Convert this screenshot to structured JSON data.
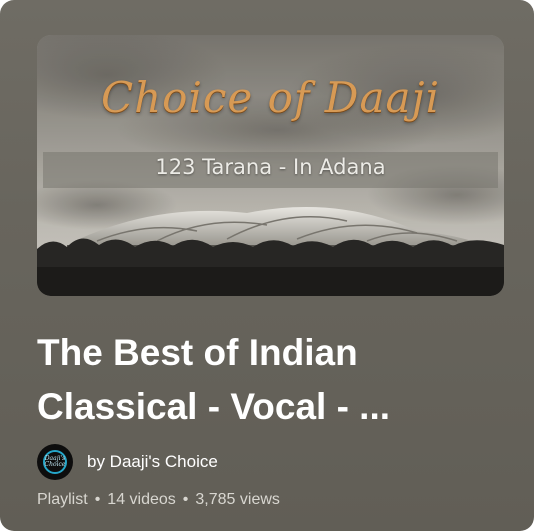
{
  "thumbnail": {
    "script_title": "Choice of Daaji",
    "subtitle": "123 Tarana - In Adana"
  },
  "playlist": {
    "title": "The Best of Indian Classical - Vocal - ...",
    "channel_prefix_name": "by Daaji's Choice",
    "avatar_text": "Daaji's Choice",
    "type_label": "Playlist",
    "separator": "•",
    "video_count": "14 videos",
    "view_count": "3,785 views"
  },
  "colors": {
    "card_background": "#68655d",
    "title_text": "#ffffff",
    "meta_text": "#d8d6d0",
    "thumbnail_title": "#d79a55",
    "avatar_ring": "#25a6c9"
  },
  "icons": {
    "avatar": "channel-avatar"
  }
}
